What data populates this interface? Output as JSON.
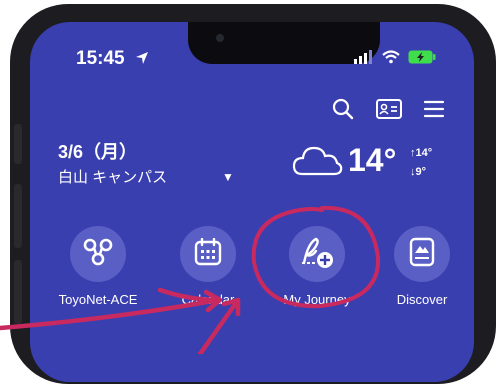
{
  "status_bar": {
    "time": "15:45",
    "icons": [
      "location-arrow-icon",
      "signal-icon",
      "wifi-icon",
      "battery-charging-icon"
    ],
    "battery_color": "#3fdc4c"
  },
  "toolbar": {
    "icons": [
      "search-icon",
      "id-card-icon",
      "menu-icon"
    ]
  },
  "header": {
    "date": "3/6（月）",
    "campus": "白山 キャンパス",
    "campus_dropdown_icon": "caret-down-icon"
  },
  "weather": {
    "icon": "cloud-icon",
    "temperature": "14°",
    "high": "↑14°",
    "low": "↓9°"
  },
  "apps": [
    {
      "label": "ToyoNet-ACE",
      "icon": "toyonet-clover-icon"
    },
    {
      "label": "Calendar",
      "icon": "calendar-icon"
    },
    {
      "label": "My Journey",
      "icon": "journey-pen-plus-icon"
    },
    {
      "label": "Discover",
      "icon": "discover-book-icon"
    }
  ],
  "colors": {
    "screen_bg": "#3a3fb0",
    "app_circle": "#5a5fc6",
    "annotation": "#c8295e"
  }
}
